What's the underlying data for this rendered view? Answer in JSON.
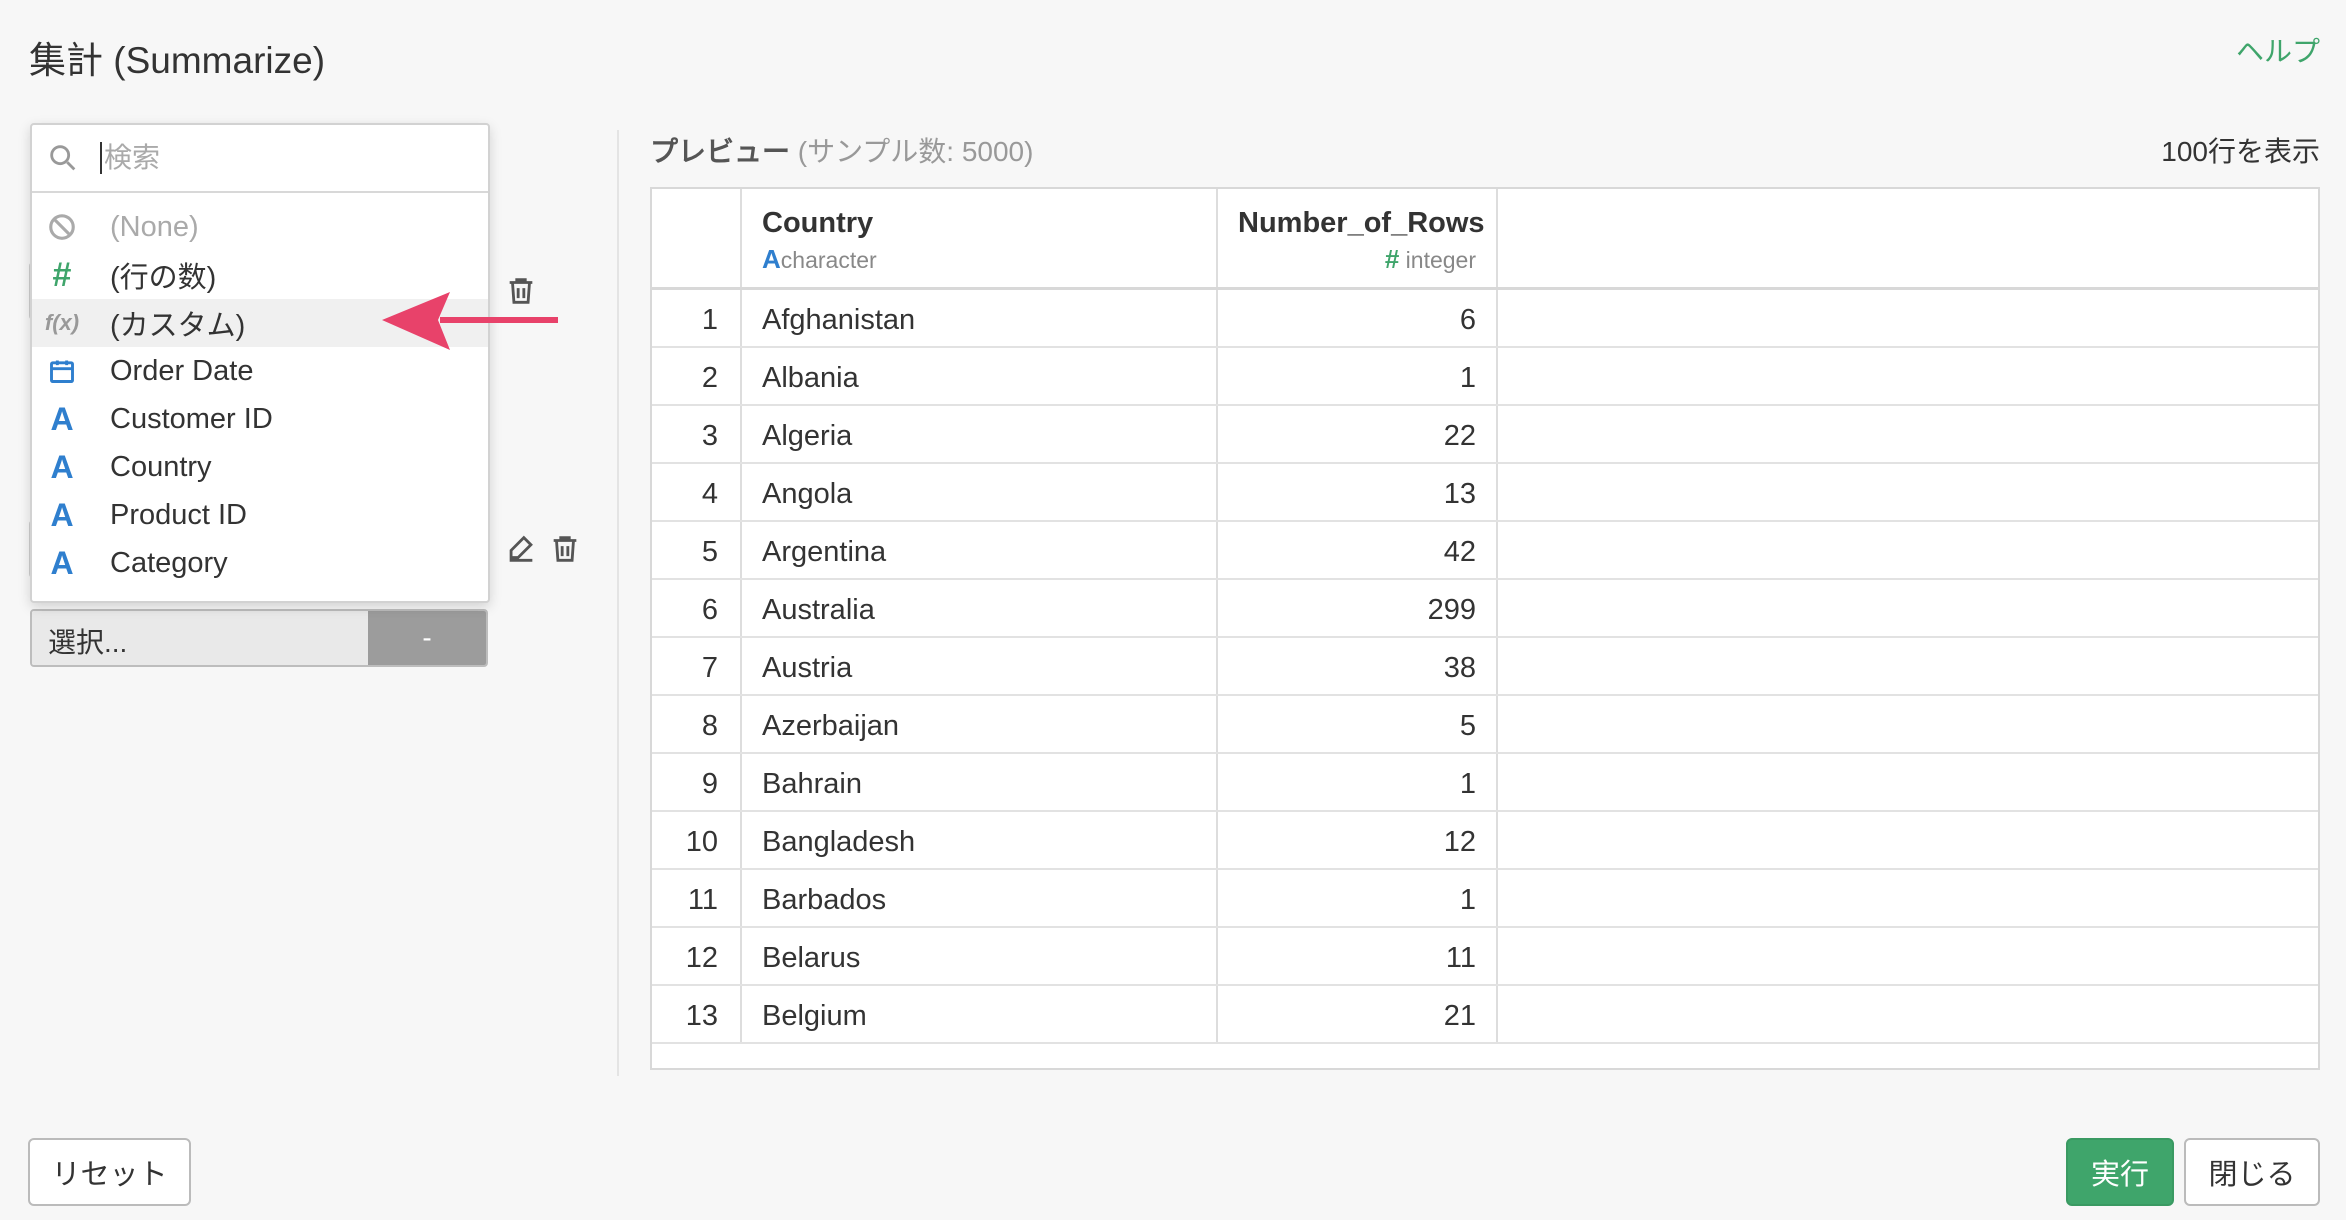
{
  "header": {
    "title": "集計 (Summarize)",
    "help": "ヘルプ"
  },
  "dropdown": {
    "search_placeholder": "検索",
    "items": [
      {
        "label": "(None)",
        "icon": "none-icon"
      },
      {
        "label": "(行の数)",
        "icon": "hash-icon"
      },
      {
        "label": "(カスタム)",
        "icon": "function-icon"
      },
      {
        "label": "Order Date",
        "icon": "calendar-icon"
      },
      {
        "label": "Customer ID",
        "icon": "text-type-icon"
      },
      {
        "label": "Country",
        "icon": "text-type-icon"
      },
      {
        "label": "Product ID",
        "icon": "text-type-icon"
      },
      {
        "label": "Category",
        "icon": "text-type-icon"
      }
    ]
  },
  "select": {
    "value": "選択...",
    "minus": "-"
  },
  "preview": {
    "label": "プレビュー",
    "sample": "(サンプル数: 5000)",
    "rows_shown": "100行を表示",
    "columns": [
      {
        "name": "Country",
        "type": "character",
        "type_icon": "A"
      },
      {
        "name": "Number_of_Rows",
        "type": "integer",
        "type_icon": "#"
      }
    ],
    "rows": [
      {
        "n": "1",
        "country": "Afghanistan",
        "count": "6"
      },
      {
        "n": "2",
        "country": "Albania",
        "count": "1"
      },
      {
        "n": "3",
        "country": "Algeria",
        "count": "22"
      },
      {
        "n": "4",
        "country": "Angola",
        "count": "13"
      },
      {
        "n": "5",
        "country": "Argentina",
        "count": "42"
      },
      {
        "n": "6",
        "country": "Australia",
        "count": "299"
      },
      {
        "n": "7",
        "country": "Austria",
        "count": "38"
      },
      {
        "n": "8",
        "country": "Azerbaijan",
        "count": "5"
      },
      {
        "n": "9",
        "country": "Bahrain",
        "count": "1"
      },
      {
        "n": "10",
        "country": "Bangladesh",
        "count": "12"
      },
      {
        "n": "11",
        "country": "Barbados",
        "count": "1"
      },
      {
        "n": "12",
        "country": "Belarus",
        "count": "11"
      },
      {
        "n": "13",
        "country": "Belgium",
        "count": "21"
      }
    ]
  },
  "footer": {
    "reset": "リセット",
    "run": "実行",
    "close": "閉じる"
  },
  "colors": {
    "accent_green": "#3fa56b",
    "type_blue": "#2f7fce",
    "arrow_pink": "#e8426a"
  }
}
